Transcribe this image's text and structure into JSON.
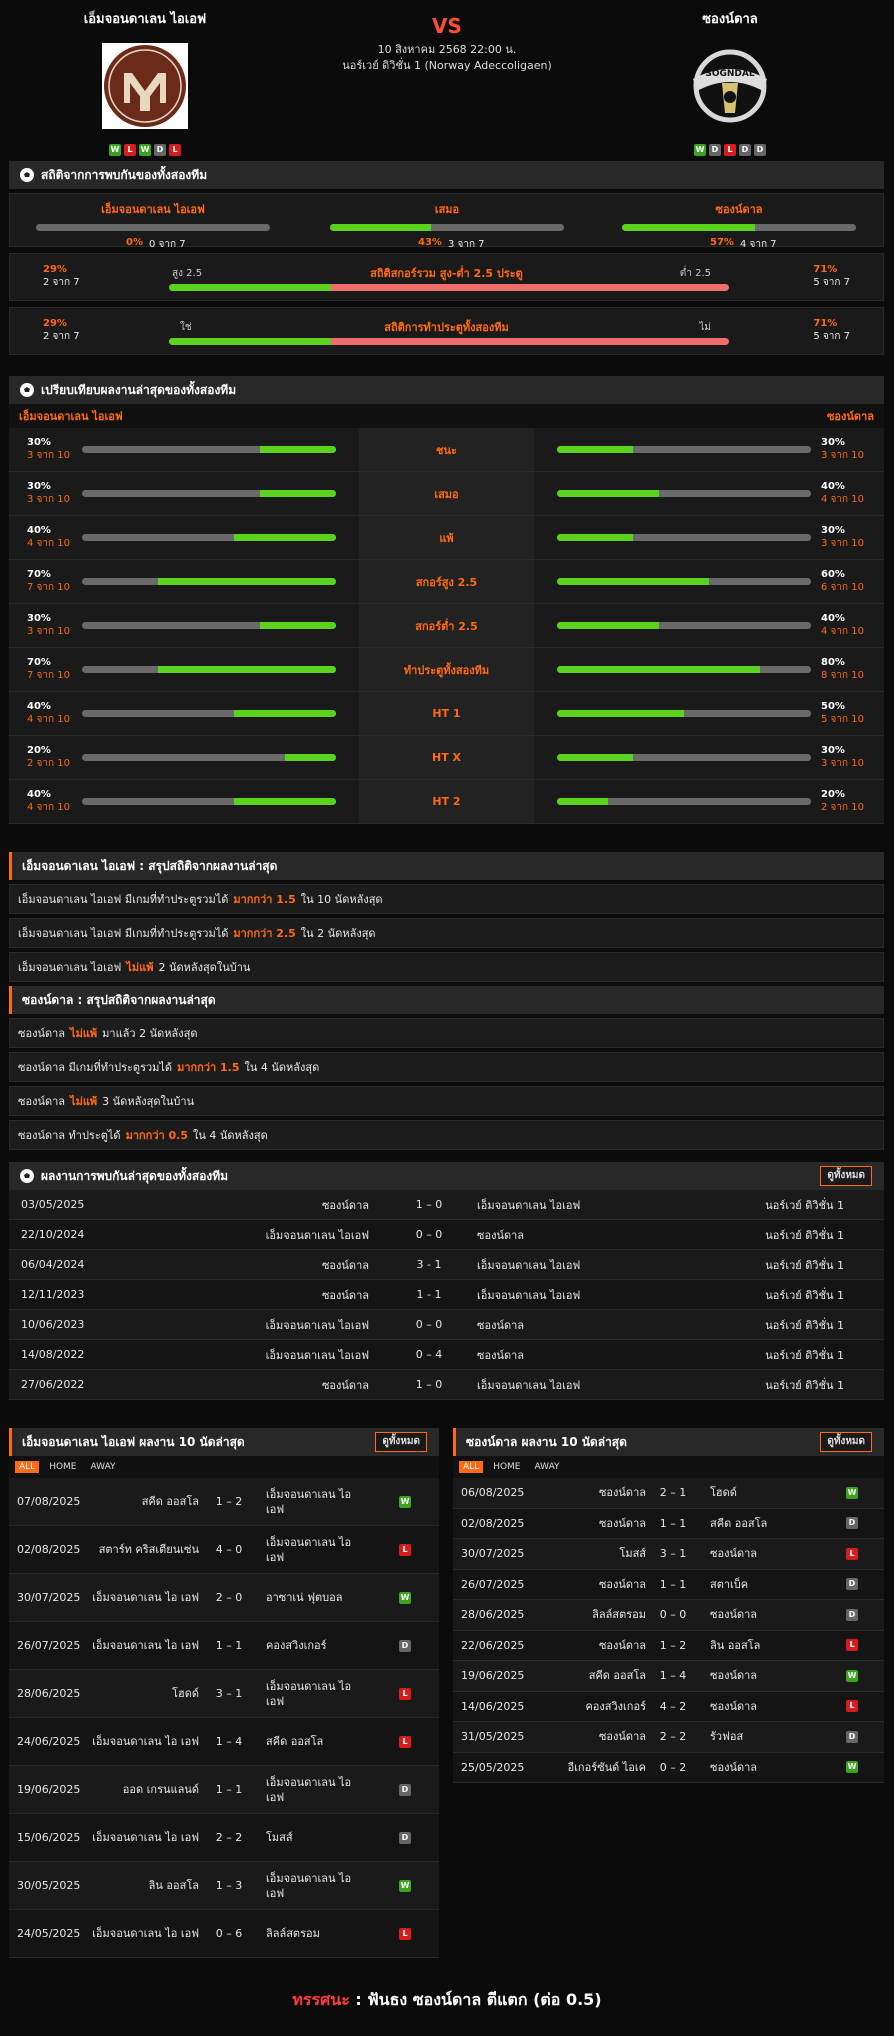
{
  "home": {
    "name": "เอ็มจอนดาเลน ไอเอฟ",
    "form": [
      "W",
      "L",
      "W",
      "D",
      "L"
    ]
  },
  "away": {
    "name": "ซองน์ดาล",
    "form": [
      "W",
      "D",
      "L",
      "D",
      "D"
    ],
    "logo_text": "SOGNDAL"
  },
  "match": {
    "vs": "VS",
    "datetime": "10 สิงหาคม 2568 22:00 น.",
    "league": "นอร์เวย์ ดิวิชั่น 1 (Norway Adeccoligaen)"
  },
  "h2h_stats": {
    "title": "สถิติจากการพบกันของทั้งสองทีม",
    "cols": [
      {
        "label": "เอ็มจอนดาเลน ไอเอฟ",
        "pct": "0%",
        "of": "0 จาก 7",
        "value": 0
      },
      {
        "label": "เสมอ",
        "pct": "43%",
        "of": "3 จาก 7",
        "value": 43
      },
      {
        "label": "ซองน์ดาล",
        "pct": "57%",
        "of": "4 จาก 7",
        "value": 57
      }
    ],
    "ou": {
      "title": "สถิติสกอร์รวม สูง-ต่ำ 2.5 ประตู",
      "left_pct": "29%",
      "left_of": "2 จาก 7",
      "right_pct": "71%",
      "right_of": "5 จาก 7",
      "left_label": "สูง 2.5",
      "right_label": "ต่ำ 2.5",
      "value": 29
    },
    "btts": {
      "title": "สถิติการทำประตูทั้งสองทีม",
      "left_pct": "29%",
      "left_of": "2 จาก 7",
      "right_pct": "71%",
      "right_of": "5 จาก 7",
      "left_label": "ใช่",
      "right_label": "ไม่",
      "value": 29
    }
  },
  "compare": {
    "title": "เปรียบเทียบผลงานล่าสุดของทั้งสองทีม",
    "home": "เอ็มจอนดาเลน ไอเอฟ",
    "away": "ซองน์ดาล",
    "rows": [
      {
        "label": "ชนะ",
        "lp": "30%",
        "lo": "3 จาก 10",
        "lv": 30,
        "rp": "30%",
        "ro": "3 จาก 10",
        "rv": 30
      },
      {
        "label": "เสมอ",
        "lp": "30%",
        "lo": "3 จาก 10",
        "lv": 30,
        "rp": "40%",
        "ro": "4 จาก 10",
        "rv": 40
      },
      {
        "label": "แพ้",
        "lp": "40%",
        "lo": "4 จาก 10",
        "lv": 40,
        "rp": "30%",
        "ro": "3 จาก 10",
        "rv": 30
      },
      {
        "label": "สกอร์สูง 2.5",
        "lp": "70%",
        "lo": "7 จาก 10",
        "lv": 70,
        "rp": "60%",
        "ro": "6 จาก 10",
        "rv": 60
      },
      {
        "label": "สกอร์ต่ำ 2.5",
        "lp": "30%",
        "lo": "3 จาก 10",
        "lv": 30,
        "rp": "40%",
        "ro": "4 จาก 10",
        "rv": 40
      },
      {
        "label": "ทำประตูทั้งสองทีม",
        "lp": "70%",
        "lo": "7 จาก 10",
        "lv": 70,
        "rp": "80%",
        "ro": "8 จาก 10",
        "rv": 80
      },
      {
        "label": "HT 1",
        "lp": "40%",
        "lo": "4 จาก 10",
        "lv": 40,
        "rp": "50%",
        "ro": "5 จาก 10",
        "rv": 50
      },
      {
        "label": "HT X",
        "lp": "20%",
        "lo": "2 จาก 10",
        "lv": 20,
        "rp": "30%",
        "ro": "3 จาก 10",
        "rv": 30
      },
      {
        "label": "HT 2",
        "lp": "40%",
        "lo": "4 จาก 10",
        "lv": 40,
        "rp": "20%",
        "ro": "2 จาก 10",
        "rv": 20
      }
    ]
  },
  "home_summary": {
    "title": "เอ็มจอนดาเลน ไอเอฟ : สรุปสถิติจากผลงานล่าสุด",
    "rows": [
      [
        "เอ็มจอนดาเลน ไอเอฟ  มีเกมที่ทำประตูรวมได้",
        "มากกว่า  1.5",
        "ใน 10 นัดหลังสุด"
      ],
      [
        "เอ็มจอนดาเลน ไอเอฟ  มีเกมที่ทำประตูรวมได้",
        "มากกว่า  2.5",
        "ใน 2 นัดหลังสุด"
      ],
      [
        "เอ็มจอนดาเลน ไอเอฟ",
        "ไม่แพ้",
        "2  นัดหลังสุดในบ้าน"
      ]
    ]
  },
  "away_summary": {
    "title": "ซองน์ดาล : สรุปสถิติจากผลงานล่าสุด",
    "rows": [
      [
        "ซองน์ดาล",
        "ไม่แพ้",
        "มาแล้ว 2 นัดหลังสุด"
      ],
      [
        "ซองน์ดาล  มีเกมที่ทำประตูรวมได้",
        "มากกว่า  1.5",
        "ใน 4 นัดหลังสุด"
      ],
      [
        "ซองน์ดาล",
        "ไม่แพ้",
        "3  นัดหลังสุดในบ้าน"
      ],
      [
        "ซองน์ดาล  ทำประตูได้",
        "มากกว่า  0.5",
        "ใน 4 นัดหลังสุด"
      ]
    ]
  },
  "h2h_list": {
    "title": "ผลงานการพบกันล่าสุดของทั้งสองทีม",
    "view_all": "ดูทั้งหมด",
    "rows": [
      [
        "03/05/2025",
        "ซองน์ดาล",
        "1 – 0",
        "เอ็มจอนดาเลน ไอเอฟ",
        "นอร์เวย์ ดิวิชั่น 1"
      ],
      [
        "22/10/2024",
        "เอ็มจอนดาเลน ไอเอฟ",
        "0 – 0",
        "ซองน์ดาล",
        "นอร์เวย์ ดิวิชั่น 1"
      ],
      [
        "06/04/2024",
        "ซองน์ดาล",
        "3 - 1",
        "เอ็มจอนดาเลน ไอเอฟ",
        "นอร์เวย์ ดิวิชั่น 1"
      ],
      [
        "12/11/2023",
        "ซองน์ดาล",
        "1 - 1",
        "เอ็มจอนดาเลน ไอเอฟ",
        "นอร์เวย์ ดิวิชั่น 1"
      ],
      [
        "10/06/2023",
        "เอ็มจอนดาเลน ไอเอฟ",
        "0 – 0",
        "ซองน์ดาล",
        "นอร์เวย์ ดิวิชั่น 1"
      ],
      [
        "14/08/2022",
        "เอ็มจอนดาเลน ไอเอฟ",
        "0 – 4",
        "ซองน์ดาล",
        "นอร์เวย์ ดิวิชั่น 1"
      ],
      [
        "27/06/2022",
        "ซองน์ดาล",
        "1 – 0",
        "เอ็มจอนดาเลน ไอเอฟ",
        "นอร์เวย์ ดิวิชั่น 1"
      ]
    ]
  },
  "home_last10": {
    "title": "เอ็มจอนดาเลน ไอเอฟ ผลงาน 10 นัดล่าสุด",
    "view_all": "ดูทั้งหมด",
    "tabs": [
      "ALL",
      "HOME",
      "AWAY"
    ],
    "rows": [
      [
        "07/08/2025",
        "สคีด ออสโล",
        "1 – 2",
        "เอ็มจอนดาเลน ไอ เอฟ",
        "W"
      ],
      [
        "02/08/2025",
        "สตาร์ท คริสเตียนเซ่น",
        "4 – 0",
        "เอ็มจอนดาเลน ไอ เอฟ",
        "L"
      ],
      [
        "30/07/2025",
        "เอ็มจอนดาเลน ไอ เอฟ",
        "2 – 0",
        "อาซาเน่ ฟุตบอล",
        "W"
      ],
      [
        "26/07/2025",
        "เอ็มจอนดาเลน ไอ เอฟ",
        "1 – 1",
        "คองสวิงเกอร์",
        "D"
      ],
      [
        "28/06/2025",
        "โฮดด์",
        "3 – 1",
        "เอ็มจอนดาเลน ไอ เอฟ",
        "L"
      ],
      [
        "24/06/2025",
        "เอ็มจอนดาเลน ไอ เอฟ",
        "1 – 4",
        "สคีด ออสโล",
        "L"
      ],
      [
        "19/06/2025",
        "ออด เกรนแลนด์",
        "1 – 1",
        "เอ็มจอนดาเลน ไอ เอฟ",
        "D"
      ],
      [
        "15/06/2025",
        "เอ็มจอนดาเลน ไอ เอฟ",
        "2 – 2",
        "โมสส์",
        "D"
      ],
      [
        "30/05/2025",
        "ลิน ออสโล",
        "1 – 3",
        "เอ็มจอนดาเลน ไอ เอฟ",
        "W"
      ],
      [
        "24/05/2025",
        "เอ็มจอนดาเลน ไอ เอฟ",
        "0 – 6",
        "ลิลล์สตรอม",
        "L"
      ]
    ]
  },
  "away_last10": {
    "title": "ซองน์ดาล ผลงาน 10 นัดล่าสุด",
    "view_all": "ดูทั้งหมด",
    "tabs": [
      "ALL",
      "HOME",
      "AWAY"
    ],
    "rows": [
      [
        "06/08/2025",
        "ซองน์ดาล",
        "2 – 1",
        "โฮดด์",
        "W"
      ],
      [
        "02/08/2025",
        "ซองน์ดาล",
        "1 – 1",
        "สคีด ออสโล",
        "D"
      ],
      [
        "30/07/2025",
        "โมสส์",
        "3 – 1",
        "ซองน์ดาล",
        "L"
      ],
      [
        "26/07/2025",
        "ซองน์ดาล",
        "1 – 1",
        "สตาเบ็ค",
        "D"
      ],
      [
        "28/06/2025",
        "ลิลล์สตรอม",
        "0 – 0",
        "ซองน์ดาล",
        "D"
      ],
      [
        "22/06/2025",
        "ซองน์ดาล",
        "1 – 2",
        "ลิน ออสโล",
        "L"
      ],
      [
        "19/06/2025",
        "สคีด ออสโล",
        "1 – 4",
        "ซองน์ดาล",
        "W"
      ],
      [
        "14/06/2025",
        "คองสวิงเกอร์",
        "4 – 2",
        "ซองน์ดาล",
        "L"
      ],
      [
        "31/05/2025",
        "ซองน์ดาล",
        "2 – 2",
        "รัวฟอส",
        "D"
      ],
      [
        "25/05/2025",
        "อีเกอร์ซันด์ ไอเค",
        "0 – 2",
        "ซองน์ดาล",
        "W"
      ]
    ]
  },
  "verdict": {
    "label": "ทรรศนะ",
    "colon": ":",
    "text": "ฟันธง ซองน์ดาล ตีแตก (ต่อ 0.5)"
  },
  "colors": {
    "accent": "#ff6a13",
    "green": "#5bd21d",
    "red": "#f06d6d"
  }
}
